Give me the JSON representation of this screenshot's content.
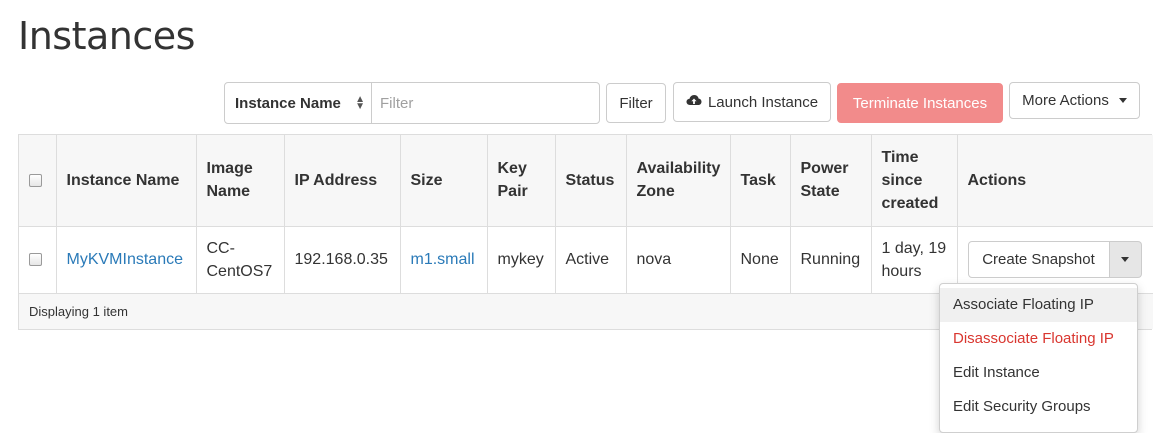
{
  "page": {
    "title": "Instances"
  },
  "toolbar": {
    "filter_field": "Instance Name",
    "filter_placeholder": "Filter",
    "filter_button": "Filter",
    "launch_button": "Launch Instance",
    "launch_icon": "cloud-upload-icon",
    "terminate_button": "Terminate Instances",
    "more_actions": "More Actions",
    "colors": {
      "terminate": "#f28b8b",
      "link": "#2a7ab8",
      "danger": "#d9362f"
    }
  },
  "table": {
    "columns": [
      {
        "key": "name",
        "label": "Instance Name"
      },
      {
        "key": "image",
        "label": "Image Name"
      },
      {
        "key": "ip",
        "label": "IP Address"
      },
      {
        "key": "size",
        "label": "Size"
      },
      {
        "key": "keypair",
        "label": "Key Pair"
      },
      {
        "key": "status",
        "label": "Status"
      },
      {
        "key": "az",
        "label": "Availability Zone"
      },
      {
        "key": "task",
        "label": "Task"
      },
      {
        "key": "power",
        "label": "Power State"
      },
      {
        "key": "age",
        "label": "Time since created"
      },
      {
        "key": "actions",
        "label": "Actions"
      }
    ],
    "rows": [
      {
        "name": "MyKVMInstance",
        "image": "CC-CentOS7",
        "ip": "192.168.0.35",
        "size": "m1.small",
        "keypair": "mykey",
        "status": "Active",
        "az": "nova",
        "task": "None",
        "power": "Running",
        "age": "1 day, 19 hours",
        "action_button": "Create Snapshot"
      }
    ],
    "footer": "Displaying 1 item"
  },
  "row_menu": {
    "items": [
      {
        "label": "Associate Floating IP",
        "style": "active"
      },
      {
        "label": "Disassociate Floating IP",
        "style": "danger"
      },
      {
        "label": "Edit Instance",
        "style": "normal"
      },
      {
        "label": "Edit Security Groups",
        "style": "normal"
      }
    ]
  }
}
